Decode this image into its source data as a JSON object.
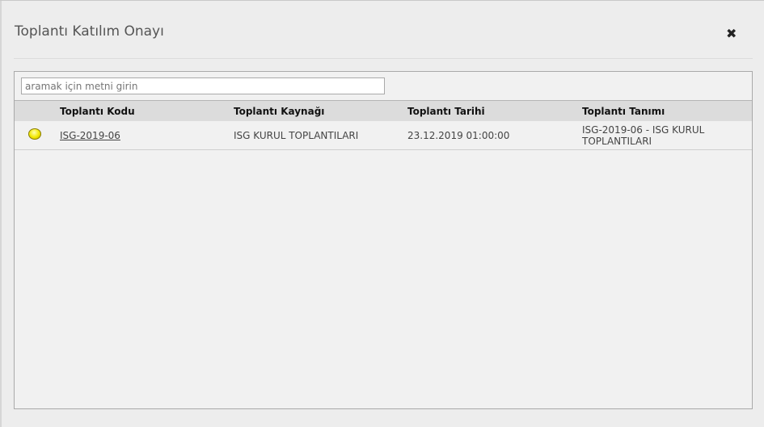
{
  "dialog": {
    "title": "Toplantı Katılım Onayı",
    "close_icon": "close-icon"
  },
  "search": {
    "placeholder": "aramak için metni girin",
    "value": ""
  },
  "table": {
    "headers": [
      "",
      "Toplantı Kodu",
      "Toplantı Kaynağı",
      "Toplantı Tarihi",
      "Toplantı Tanımı"
    ],
    "rows": [
      {
        "status_color": "#f2e800",
        "code": "ISG-2019-06",
        "source": "ISG KURUL TOPLANTILARI",
        "date": "23.12.2019 01:00:00",
        "description": "ISG-2019-06 - ISG KURUL TOPLANTILARI"
      }
    ]
  }
}
